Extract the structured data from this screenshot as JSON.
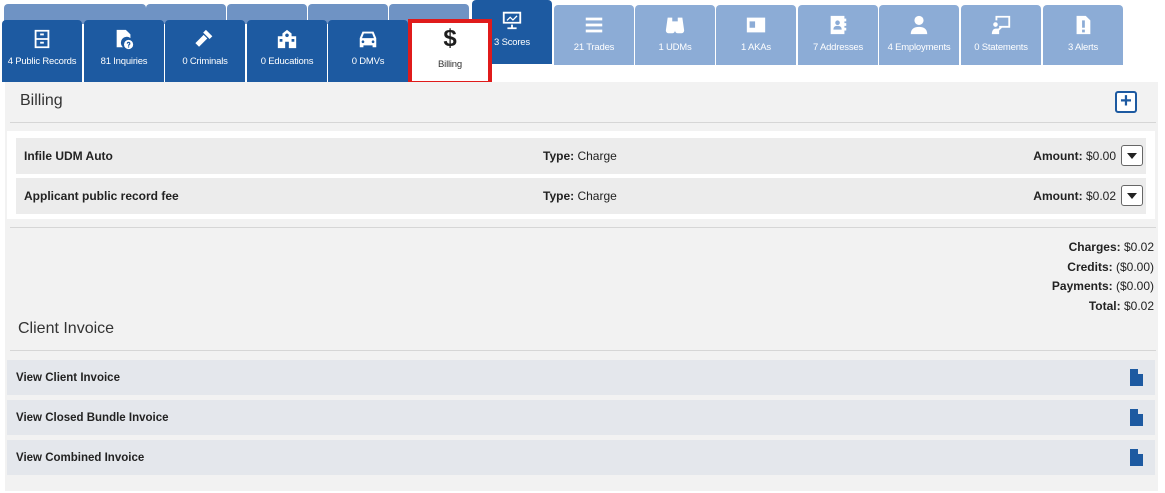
{
  "tabs": {
    "back": [
      {
        "name": "tab-back-1",
        "icon": "folder-icon"
      },
      {
        "name": "tab-back-2",
        "icon": "card-icon"
      },
      {
        "name": "tab-back-3",
        "icon": "vehicle-icon"
      },
      {
        "name": "tab-back-4",
        "icon": "copy-icon"
      },
      {
        "name": "tab-back-5",
        "icon": "tag-icon"
      },
      {
        "name": "tab-back-6",
        "icon": "list-icon"
      }
    ],
    "upper": [
      {
        "label": "3 Scores",
        "icon": "presentation-chart-icon"
      },
      {
        "label": "21 Trades",
        "icon": "menu-lines-icon"
      },
      {
        "label": "1 UDMs",
        "icon": "binoculars-icon"
      },
      {
        "label": "1 AKAs",
        "icon": "id-card-icon"
      },
      {
        "label": "7 Addresses",
        "icon": "address-book-icon"
      },
      {
        "label": "4 Employments",
        "icon": "user-tie-icon"
      },
      {
        "label": "0 Statements",
        "icon": "presenter-icon"
      },
      {
        "label": "3 Alerts",
        "icon": "alert-file-icon"
      }
    ],
    "front": [
      {
        "label": "4 Public Records",
        "icon": "file-cabinet-icon"
      },
      {
        "label": "81 Inquiries",
        "icon": "file-question-icon"
      },
      {
        "label": "0 Criminals",
        "icon": "gavel-icon"
      },
      {
        "label": "0 Educations",
        "icon": "school-icon"
      },
      {
        "label": "0 DMVs",
        "icon": "car-icon"
      },
      {
        "label": "Billing",
        "icon": "dollar-icon",
        "glyph": "$"
      }
    ]
  },
  "billing": {
    "title": "Billing",
    "add_icon": "plus-icon",
    "items": [
      {
        "name": "Infile UDM Auto",
        "type_label": "Type:",
        "type_value": "Charge",
        "amount_label": "Amount:",
        "amount_value": "$0.00"
      },
      {
        "name": "Applicant public record fee",
        "type_label": "Type:",
        "type_value": "Charge",
        "amount_label": "Amount:",
        "amount_value": "$0.02"
      }
    ],
    "totals": [
      {
        "label": "Charges:",
        "value": "$0.02"
      },
      {
        "label": "Credits:",
        "value": "($0.00)"
      },
      {
        "label": "Payments:",
        "value": "($0.00)"
      },
      {
        "label": "Total:",
        "value": "$0.02"
      }
    ]
  },
  "client_invoice": {
    "title": "Client Invoice",
    "rows": [
      {
        "label": "View Client Invoice"
      },
      {
        "label": "View Closed Bundle Invoice"
      },
      {
        "label": "View Combined Invoice"
      }
    ],
    "row_icon": "document-icon"
  },
  "colors": {
    "tab_dark": "#1d5aa1",
    "tab_light": "#8cacd6",
    "tab_back": "#6f93c4",
    "active_outline": "#e01b1b",
    "panel_bg": "#f2f2f2"
  }
}
